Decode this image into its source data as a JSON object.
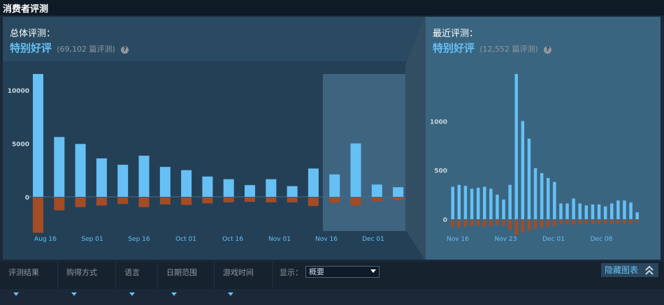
{
  "page_title": "消费者评测",
  "overall": {
    "label": "总体评测：",
    "rating": "特别好评",
    "count": "(69,102 篇评测)",
    "help_icon": "question-icon"
  },
  "recent": {
    "label": "最近评测：",
    "rating": "特别好评",
    "count": "(12,552 篇评测)",
    "help_icon": "question-icon"
  },
  "filters": {
    "items": [
      "评测结果",
      "购得方式",
      "语言",
      "日期范围",
      "游戏时间"
    ],
    "show_label": "显示：",
    "show_value": "概要"
  },
  "hide_chart_label": "隐藏图表",
  "colors": {
    "positive": "#66c0f4",
    "negative": "#a34c25",
    "highlight": "#3e6480"
  },
  "chart_data": [
    {
      "type": "bar",
      "x_tick_labels": [
        "Aug 16",
        "Sep 01",
        "Sep 16",
        "Oct 01",
        "Oct 16",
        "Nov 01",
        "Nov 16",
        "Dec 01"
      ],
      "y_tick_labels": [
        "10000",
        "5000",
        "0"
      ],
      "ylim": [
        -3300,
        11500
      ],
      "series": [
        {
          "values": [
            11500,
            5600,
            4950,
            3600,
            3000,
            3850,
            2800,
            2500,
            1900,
            1650,
            1100,
            1650,
            1000,
            2650,
            2100,
            5000,
            1150,
            900
          ]
        },
        {
          "values": [
            -3300,
            -1200,
            -900,
            -750,
            -600,
            -900,
            -650,
            -700,
            -550,
            -450,
            -400,
            -450,
            -450,
            -800,
            -500,
            -750,
            -350,
            -250
          ]
        }
      ],
      "highlighted_range": "Nov 16 – Dec 08"
    },
    {
      "type": "bar",
      "x_tick_labels": [
        "Nov 16",
        "Nov 23",
        "Dec 01",
        "Dec 08"
      ],
      "y_tick_labels": [
        "1000",
        "500",
        "0"
      ],
      "ylim": [
        -150,
        1480
      ],
      "series": [
        {
          "values": [
            330,
            350,
            340,
            310,
            320,
            330,
            310,
            250,
            200,
            350,
            1480,
            1000,
            820,
            520,
            470,
            420,
            380,
            160,
            160,
            210,
            160,
            140,
            150,
            150,
            130,
            160,
            190,
            190,
            170,
            70
          ]
        },
        {
          "values": [
            -70,
            -80,
            -70,
            -60,
            -60,
            -70,
            -60,
            -50,
            -60,
            -100,
            -150,
            -130,
            -110,
            -90,
            -80,
            -70,
            -60,
            -40,
            -40,
            -50,
            -40,
            -40,
            -40,
            -40,
            -40,
            -40,
            -40,
            -40,
            -40,
            -20
          ]
        }
      ]
    }
  ]
}
